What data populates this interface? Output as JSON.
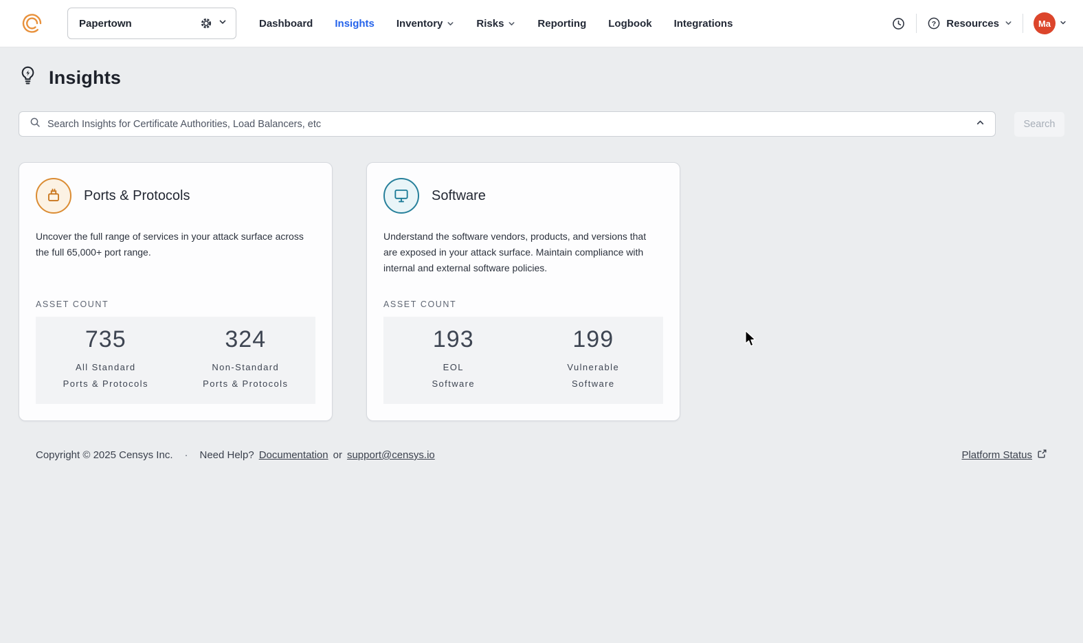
{
  "colors": {
    "brand_orange": "#E8913C",
    "nav_active_blue": "#2563EB",
    "avatar_red": "#DC452B",
    "ports_icon_orange": "#C9771F",
    "software_icon_teal": "#1A7A96",
    "page_background": "#EBEDEF"
  },
  "header": {
    "workspace_name": "Papertown",
    "nav": [
      {
        "label": "Dashboard"
      },
      {
        "label": "Insights"
      },
      {
        "label": "Inventory"
      },
      {
        "label": "Risks"
      },
      {
        "label": "Reporting"
      },
      {
        "label": "Logbook"
      },
      {
        "label": "Integrations"
      }
    ],
    "resources_label": "Resources",
    "avatar_initials": "Ma"
  },
  "page": {
    "title": "Insights",
    "search_placeholder": "Search Insights for Certificate Authorities, Load Balancers, etc",
    "search_button_label": "Search"
  },
  "cards": [
    {
      "title": "Ports & Protocols",
      "description": "Uncover the full range of services in your attack surface across the full 65,000+ port range.",
      "asset_count_label": "ASSET COUNT",
      "stats": [
        {
          "value": "735",
          "label_line1": "All Standard",
          "label_line2": "Ports & Protocols"
        },
        {
          "value": "324",
          "label_line1": "Non-Standard",
          "label_line2": "Ports & Protocols"
        }
      ]
    },
    {
      "title": "Software",
      "description": "Understand the software vendors, products, and versions that are exposed in your attack surface. Maintain compliance with internal and external software policies.",
      "asset_count_label": "ASSET COUNT",
      "stats": [
        {
          "value": "193",
          "label_line1": "EOL",
          "label_line2": "Software"
        },
        {
          "value": "199",
          "label_line1": "Vulnerable",
          "label_line2": "Software"
        }
      ]
    }
  ],
  "footer": {
    "copyright": "Copyright © 2025 Censys Inc.",
    "dot": "·",
    "need_help": "Need Help?",
    "documentation_link": "Documentation",
    "or_text": "or",
    "support_link": "support@censys.io",
    "platform_status_link": "Platform Status"
  }
}
